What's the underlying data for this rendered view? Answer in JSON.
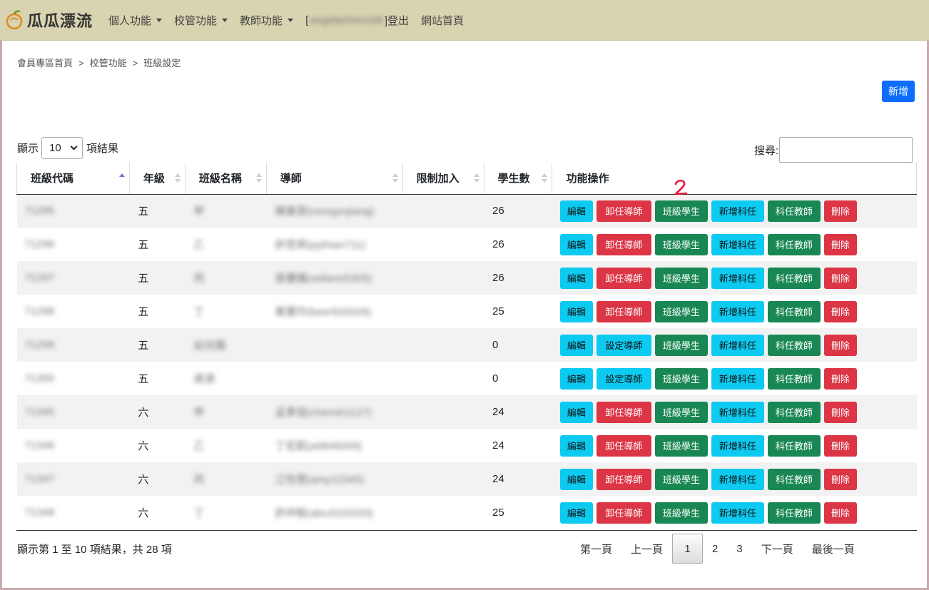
{
  "header": {
    "logo_text": "瓜瓜漂流",
    "nav": [
      {
        "label": "個人功能",
        "dropdown": true
      },
      {
        "label": "校管功能",
        "dropdown": true
      },
      {
        "label": "教師功能",
        "dropdown": true
      }
    ],
    "user_prefix": "[",
    "user_name": "angelachen108",
    "logout": "]登出",
    "home": "網站首頁"
  },
  "breadcrumb": [
    "會員專區首頁",
    "校管功能",
    "班級設定"
  ],
  "breadcrumb_sep": ">",
  "new_button": "新增",
  "length_control": {
    "prefix": "顯示",
    "value": "10",
    "suffix": "項結果"
  },
  "search_label": "搜尋:",
  "table": {
    "columns": [
      "班級代碼",
      "年級",
      "班級名稱",
      "導師",
      "限制加入",
      "學生數",
      "功能操作"
    ],
    "rows": [
      {
        "code": "71295",
        "grade": "五",
        "name": "甲",
        "teacher": "陳業翠(ronxgxxjiang)",
        "limit": "",
        "students": "26",
        "remove_label": "卸任導師"
      },
      {
        "code": "71296",
        "grade": "五",
        "name": "乙",
        "teacher": "許思齊(pythian711)",
        "limit": "",
        "students": "26",
        "remove_label": "卸任導師"
      },
      {
        "code": "71297",
        "grade": "五",
        "name": "丙",
        "teacher": "張儷儀(seliano5305)",
        "limit": "",
        "students": "26",
        "remove_label": "卸任導師"
      },
      {
        "code": "71298",
        "grade": "五",
        "name": "丁",
        "teacher": "黃蕙玲(beer920026)",
        "limit": "",
        "students": "25",
        "remove_label": "卸任導師"
      },
      {
        "code": "71299",
        "grade": "五",
        "name": "幼兒園",
        "teacher": "",
        "limit": "",
        "students": "0",
        "remove_label": "設定導師"
      },
      {
        "code": "71300",
        "grade": "五",
        "name": "資源",
        "teacher": "",
        "limit": "",
        "students": "0",
        "remove_label": "設定導師"
      },
      {
        "code": "71345",
        "grade": "六",
        "name": "甲",
        "teacher": "孟季瑄(cherish1127)",
        "limit": "",
        "students": "24",
        "remove_label": "卸任導師"
      },
      {
        "code": "71346",
        "grade": "六",
        "name": "乙",
        "teacher": "丁宏凱(a0846009)",
        "limit": "",
        "students": "24",
        "remove_label": "卸任導師"
      },
      {
        "code": "71347",
        "grade": "六",
        "name": "丙",
        "teacher": "江怡慧(amy12345)",
        "limit": "",
        "students": "24",
        "remove_label": "卸任導師"
      },
      {
        "code": "71348",
        "grade": "六",
        "name": "丁",
        "teacher": "許仲毅(abcd103333)",
        "limit": "",
        "students": "25",
        "remove_label": "卸任導師"
      }
    ],
    "actions": {
      "edit": "編輯",
      "students": "班級學生",
      "add_subject": "新增科任",
      "subject_teachers": "科任教師",
      "delete": "刪除"
    }
  },
  "info_text": "顯示第 1 至 10 項結果，共 28 項",
  "pagination": {
    "first": "第一頁",
    "prev": "上一頁",
    "pages": [
      "1",
      "2",
      "3"
    ],
    "current": "1",
    "next": "下一頁",
    "last": "最後一頁"
  },
  "annotation": "2",
  "colors": {
    "header_bg": "#d8d3b0",
    "primary": "#0d6efd",
    "info": "#0dcaf0",
    "danger": "#dc3545",
    "success": "#198754",
    "annotation": "#e8173a"
  }
}
